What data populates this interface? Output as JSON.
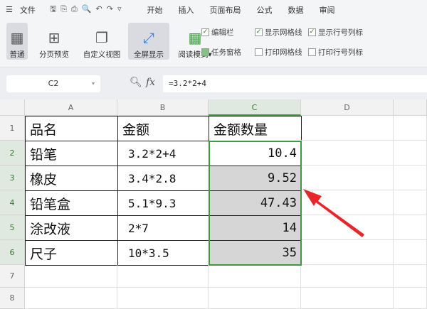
{
  "menubar": {
    "file": "文件",
    "tabs": [
      "开始",
      "插入",
      "页面布局",
      "公式",
      "数据",
      "审阅"
    ]
  },
  "ribbon": {
    "buttons": [
      "普通",
      "分页预览",
      "自定义视图",
      "全屏显示",
      "阅读模式"
    ],
    "checks": [
      {
        "label": "编辑栏",
        "checked": true
      },
      {
        "label": "任务窗格",
        "checked": true
      },
      {
        "label": "显示网格线",
        "checked": true
      },
      {
        "label": "打印网格线",
        "checked": false
      },
      {
        "label": "显示行号列标",
        "checked": true
      },
      {
        "label": "打印行号列标",
        "checked": false
      }
    ]
  },
  "formula_bar": {
    "name_box": "C2",
    "fx": "fx",
    "formula": "=3.2*2+4"
  },
  "columns": [
    "A",
    "B",
    "C",
    "D"
  ],
  "rows": [
    "1",
    "2",
    "3",
    "4",
    "5",
    "6",
    "7",
    "8"
  ],
  "table": [
    [
      "品名",
      "金额",
      "金额数量"
    ],
    [
      "铅笔",
      "3.2*2+4",
      "10.4"
    ],
    [
      "橡皮",
      "3.4*2.8",
      "9.52"
    ],
    [
      "铅笔盒",
      "5.1*9.3",
      "47.43"
    ],
    [
      "涂改液",
      "2*7",
      "14"
    ],
    [
      "尺子",
      "10*3.5",
      "35"
    ]
  ],
  "colors": {
    "accent": "#3d9a3d",
    "arrow": "#e8262a"
  }
}
